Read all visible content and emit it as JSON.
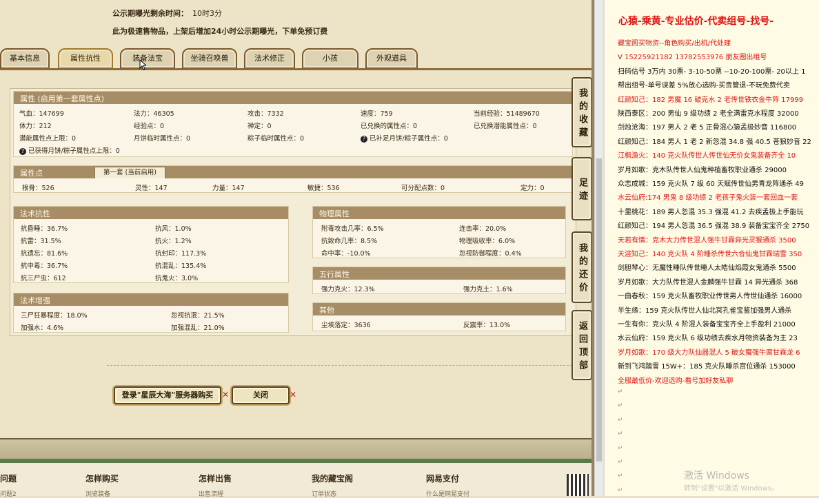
{
  "notice": {
    "time_label": "公示期曝光剩余时间：",
    "time_value": "10时3分",
    "desc": "此为极速售物品，上架后增加24小时公示期曝光，下单免预订费"
  },
  "tabs": [
    "基本信息",
    "属性抗性",
    "装备法宝",
    "坐骑召唤兽",
    "法术修正",
    "小孩",
    "外观道具"
  ],
  "attributes": {
    "title": "属性 (启用第一套属性点)",
    "rows": [
      [
        "气血：147699",
        "法力：46305",
        "攻击：7332",
        "速度：759",
        "当前经验：51489670"
      ],
      [
        "体力：212",
        "经验点：0",
        "禅定：0",
        "已兑换的属性点：0",
        "已兑换潜能属性点：0"
      ],
      [
        "潜能属性点上限：0",
        "月饼临时属性点：0",
        "粽子临时属性点：0",
        "已补足月饼/粽子属性点：0"
      ],
      [
        "已获得月饼/粽子属性点上限：0"
      ]
    ]
  },
  "points": {
    "title": "属性点",
    "tab": "第一套 (当前启用)",
    "values": [
      "根骨：526",
      "灵性：147",
      "力量：147",
      "敏捷：536",
      "可分配点数：0",
      "定力：0"
    ]
  },
  "spell_resist": {
    "title": "法术抗性",
    "left": [
      "抗昏睡：36.7%",
      "抗雷：31.5%",
      "抗遗忘：81.6%",
      "抗中毒：36.7%",
      "抗三尸虫：612"
    ],
    "right": [
      "抗风：1.0%",
      "抗火：1.2%",
      "抗封印：117.3%",
      "抗混乱：135.4%",
      "抗鬼火：3.0%"
    ]
  },
  "spell_boost": {
    "title": "法术增强",
    "left": [
      "三尸狂暴程度：18.0%",
      "加强水：4.6%"
    ],
    "right": [
      "忽视抗混：21.5%",
      "加强混乱：21.0%"
    ]
  },
  "physical": {
    "title": "物理属性",
    "left": [
      "附毒攻击几率：6.5%",
      "抗致命几率：8.5%",
      "命中率：-10.0%"
    ],
    "right": [
      "连击率：20.0%",
      "物理吸收率：6.0%",
      "忽视防御程度：0.4%"
    ]
  },
  "five_elements": {
    "title": "五行属性",
    "left": [
      "强力克火：12.3%"
    ],
    "right": [
      "强力克土：1.6%"
    ]
  },
  "other": {
    "title": "其他",
    "left": [
      "尘埃落定：3636"
    ],
    "right": [
      "反震率：13.0%"
    ]
  },
  "buttons": {
    "login": "登录\"星辰大海\"服务器购买",
    "close": "关闭"
  },
  "sidebar": [
    "我的收藏",
    "足迹",
    "我的还价",
    "返回顶部"
  ],
  "footer": {
    "cols": [
      "问题",
      "怎样购买",
      "怎样出售",
      "我的藏宝阁",
      "网易支付"
    ],
    "subs": [
      "问题2",
      "浏览装备",
      "出售流程",
      "订单状态",
      "什么是网易支付"
    ]
  },
  "doc": {
    "title": "心猿-乘黄-专业估价-代卖组号-找号-",
    "lines": [
      {
        "t": "藏宝阁买物资--角色购买/出机/代处理",
        "c": "red"
      },
      {
        "t": "V 15225921182   13782553976 朋友圈出组号",
        "c": "red"
      },
      {
        "t": "扫码估号 3万内 30票- 3-10-50票  --10-20-100票- 20以上 1",
        "c": "black"
      },
      {
        "t": "帮出组号-单号误差 5%放心选购-买贵管退-不玩免费代卖",
        "c": "black"
      },
      {
        "t": "红颜知己：182 男魔 16 破克水 2 老传世铁衣金牛阵 17999",
        "c": "red"
      },
      {
        "t": "陕西泰区：200 男仙 9 级功绩 2 老全满雷克水程度 32000",
        "c": "black"
      },
      {
        "t": "剑烛沧海：197 男人 2 老 5 正骨混心猿孟极妙音 116800",
        "c": "black"
      },
      {
        "t": "红颜知己：184 男人 1 老 2 新忽混 34.8 强 40.5 苍狼妙音 22",
        "c": "black"
      },
      {
        "t": "江枫渔火：140 克火队传世人传世仙无价女鬼装备齐全 10",
        "c": "red"
      },
      {
        "t": "岁月如歌：克木队传世人仙鬼种植畜牧职业通杀 29000",
        "c": "black"
      },
      {
        "t": "众志成城：159 克火队 7 级 60 天赋传世仙男青龙阵通杀 49",
        "c": "black"
      },
      {
        "t": "水云仙府:174 男鬼 8 级功绩 2 老孩子鬼火装一套回血一套",
        "c": "red"
      },
      {
        "t": "十里桃花：189 男人忽混 35.3 强混 41.2 去疾孟极上手能玩",
        "c": "black"
      },
      {
        "t": "红颜知己：194 男人忽混 36.5 强混 38.9 装备宝宝齐全 2750",
        "c": "black"
      },
      {
        "t": "天若有情：克木大力传世混人强牛甘霖异光灵猴通杀 3500",
        "c": "red"
      },
      {
        "t": "天涯知己：140 克火队 4 阶睡杀传世六合仙鬼甘霖瑞雪 350",
        "c": "red"
      },
      {
        "t": "剑胆琴心：无魔性睡队传世睡人太皓仙焰霞女鬼通杀 5500",
        "c": "black"
      },
      {
        "t": "岁月如歌：大力队传世混人金麟强牛甘霖 14 异光通杀 368",
        "c": "black"
      },
      {
        "t": "一曲春秋：159 克火队畜牧职业传世男人传世仙通杀 16000",
        "c": "black"
      },
      {
        "t": "半生缘：159 克火队传世人仙北冥孔雀宝鉴加强男人通杀",
        "c": "black"
      },
      {
        "t": "一生有你：克火队 4 阶混人装备宝宝齐全上手盈利 21000",
        "c": "black"
      },
      {
        "t": "水云仙府：159 克火队 6 级功绩去疾水月物资装备为主 23",
        "c": "black"
      },
      {
        "t": "岁月如歌：170 级大力队仙器混人 5 破女魔强牛腐甘霖龙 6",
        "c": "red"
      },
      {
        "t": "新到飞鸿踏雪 15W+：185 克火队睡杀宫位通杀 153000",
        "c": "black"
      },
      {
        "t": "全服最低价-欢迎选购-看号加好友私聊",
        "c": "red"
      }
    ]
  },
  "watermark": {
    "line1": "激活 Windows",
    "line2": "转到\"设置\"以激活 Windows。"
  },
  "colors": {
    "accent_red": "#e01414",
    "panel_header": "#a68d66",
    "frame_brown": "#7a5a2a"
  }
}
